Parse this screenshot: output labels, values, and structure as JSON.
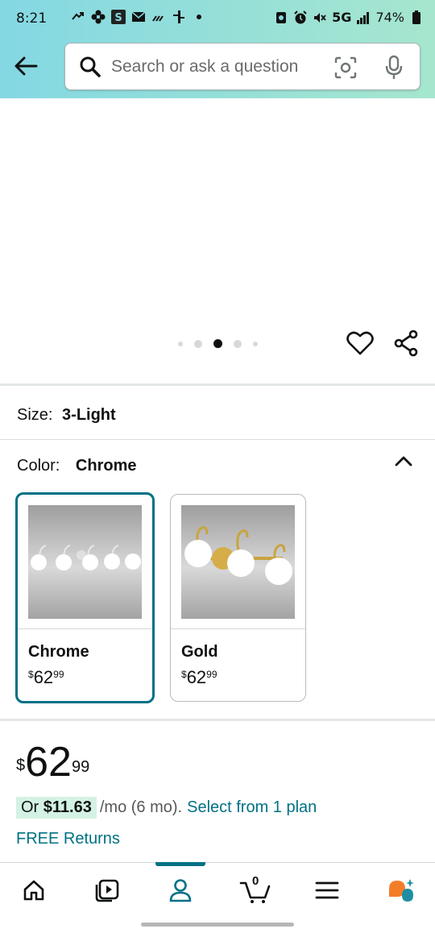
{
  "status_bar": {
    "time": "8:21",
    "network": "5G",
    "battery": "74%"
  },
  "search": {
    "placeholder": "Search or ask a question"
  },
  "gallery": {
    "dot_count": 5,
    "active_index": 2
  },
  "size": {
    "label": "Size:",
    "value": "3-Light"
  },
  "color": {
    "label": "Color:",
    "value": "Chrome"
  },
  "swatches": [
    {
      "name": "Chrome",
      "currency": "$",
      "price_whole": "62",
      "price_cents": "99",
      "selected": true
    },
    {
      "name": "Gold",
      "currency": "$",
      "price_whole": "62",
      "price_cents": "99",
      "selected": false
    }
  ],
  "price": {
    "currency": "$",
    "whole": "62",
    "cents": "99"
  },
  "monthly": {
    "prefix": "Or",
    "amount": "$11.63",
    "term": "/mo (6 mo).",
    "link": "Select from 1 plan"
  },
  "free_returns": "FREE Returns",
  "bottom_nav": {
    "cart_count": "0",
    "active": "account"
  },
  "colors": {
    "accent": "#007185",
    "header_start": "#84d8e3",
    "header_end": "#a6e6ce",
    "deal_highlight": "#d4f2e4"
  }
}
